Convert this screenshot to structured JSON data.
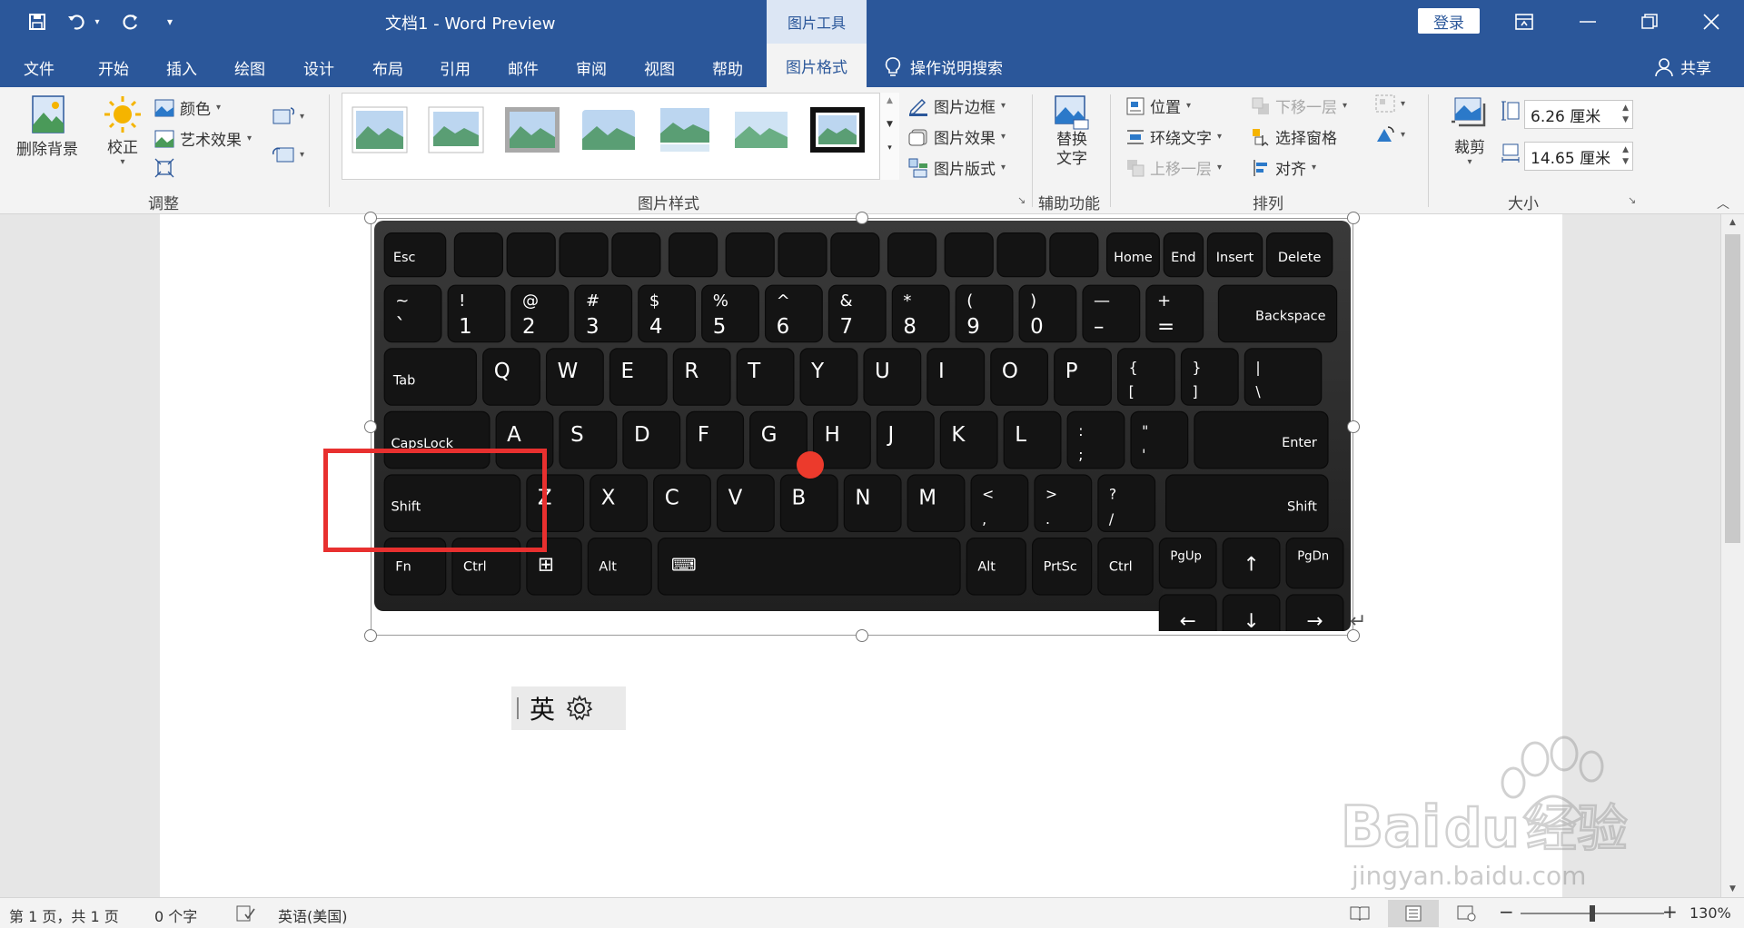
{
  "titlebar": {
    "doc_title": "文档1  -  Word Preview",
    "tools_context": "图片工具",
    "signin": "登录"
  },
  "tabs": [
    "文件",
    "开始",
    "插入",
    "绘图",
    "设计",
    "布局",
    "引用",
    "邮件",
    "审阅",
    "视图",
    "帮助"
  ],
  "active_tab": "图片格式",
  "tell_me": "操作说明搜索",
  "share": "共享",
  "ribbon": {
    "adjust": {
      "remove_bg": "删除背景",
      "corrections": "校正",
      "color": "颜色",
      "artistic": "艺术效果",
      "label": "调整"
    },
    "styles": {
      "border": "图片边框",
      "effects": "图片效果",
      "layout": "图片版式",
      "label": "图片样式"
    },
    "access": {
      "alt_text_line1": "替换",
      "alt_text_line2": "文字",
      "label": "辅助功能"
    },
    "arrange": {
      "position": "位置",
      "wrap": "环绕文字",
      "forward": "上移一层",
      "backward": "下移一层",
      "selection_pane": "选择窗格",
      "align": "对齐",
      "label": "排列"
    },
    "size": {
      "crop": "裁剪",
      "height": "6.26 厘米",
      "width": "14.65 厘米",
      "label": "大小"
    }
  },
  "ime": {
    "lang": "英"
  },
  "watermark": {
    "brand": "Bai",
    "brand_cn": "经验",
    "url": "jingyan.baidu.com"
  },
  "statusbar": {
    "page": "第 1 页，共 1 页",
    "words": "0 个字",
    "language": "英语(美国)",
    "zoom": "130%"
  },
  "keyboard": {
    "row_fn": [
      "Esc",
      "",
      "",
      "",
      "",
      "",
      "",
      "",
      "",
      "",
      "",
      "",
      "",
      "Home",
      "End",
      "Insert",
      "Delete"
    ],
    "row_num": [
      [
        "~",
        "`"
      ],
      [
        "!",
        "1"
      ],
      [
        "@",
        "2"
      ],
      [
        "#",
        "3"
      ],
      [
        "$",
        "4"
      ],
      [
        "%",
        "5"
      ],
      [
        "^",
        "6"
      ],
      [
        "&",
        "7"
      ],
      [
        "*",
        "8"
      ],
      [
        "(",
        "9"
      ],
      [
        ")",
        "0"
      ],
      [
        "—",
        "–"
      ],
      [
        "+",
        "="
      ]
    ],
    "backspace": "Backspace",
    "tab": "Tab",
    "row_q": [
      "Q",
      "W",
      "E",
      "R",
      "T",
      "Y",
      "U",
      "I",
      "O",
      "P"
    ],
    "row_q_sym": [
      [
        "{",
        "["
      ],
      [
        "}",
        "]"
      ],
      [
        "|",
        "\\"
      ]
    ],
    "capslock": "CapsLock",
    "row_a": [
      "A",
      "S",
      "D",
      "F",
      "G",
      "H",
      "J",
      "K",
      "L"
    ],
    "row_a_sym": [
      [
        ":",
        ";"
      ],
      [
        "\"",
        "'"
      ]
    ],
    "enter": "Enter",
    "shift": "Shift",
    "row_z": [
      "Z",
      "X",
      "C",
      "V",
      "B",
      "N",
      "M"
    ],
    "row_z_sym": [
      [
        "<",
        ","
      ],
      [
        ">",
        "."
      ],
      [
        "?",
        "/"
      ]
    ],
    "bottom": {
      "fn": "Fn",
      "ctrl": "Ctrl",
      "alt": "Alt",
      "alt_r": "Alt",
      "prtsc": "PrtSc",
      "ctrl_r": "Ctrl",
      "pgup": "PgUp",
      "pgdn": "PgDn"
    }
  }
}
